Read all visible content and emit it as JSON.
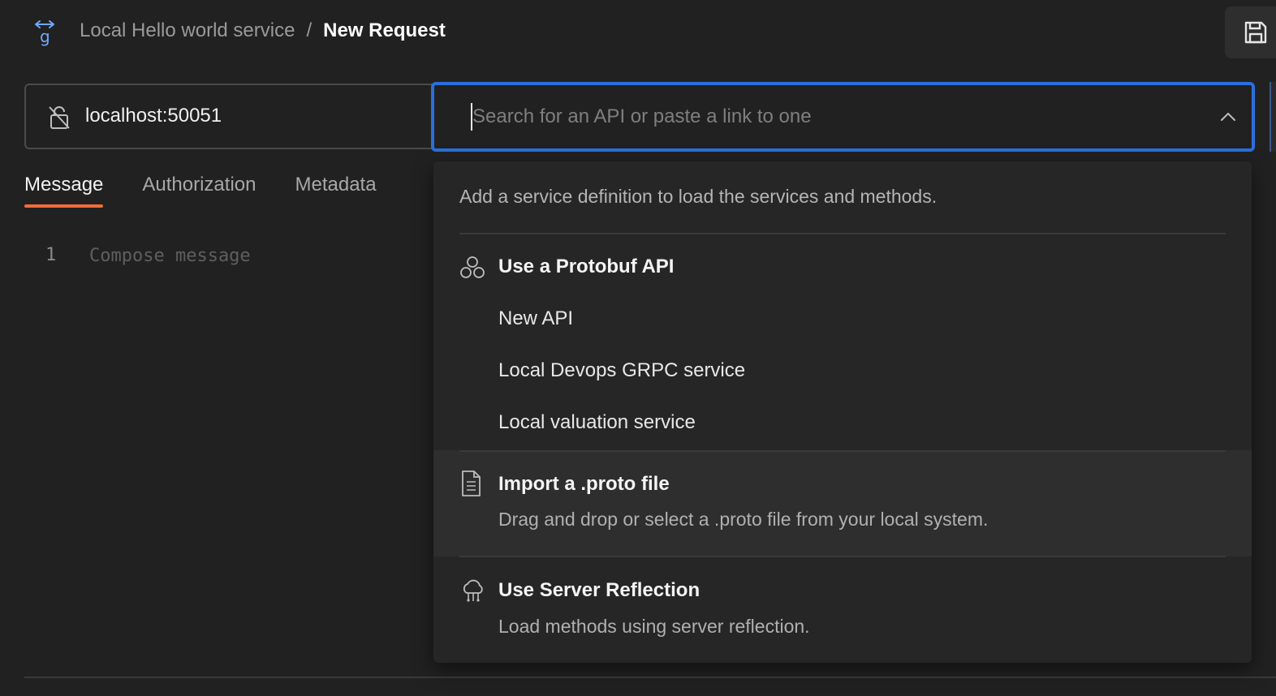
{
  "header": {
    "breadcrumb_parent": "Local Hello world service",
    "breadcrumb_separator": "/",
    "breadcrumb_current": "New Request",
    "logo_icon": "grpc-arrows-icon",
    "save_icon": "floppy-disk-icon"
  },
  "request": {
    "url": "localhost:50051",
    "tls_icon": "unlocked-slash-icon",
    "search_placeholder": "Search for an API or paste a link to one",
    "search_value": ""
  },
  "tabs": [
    {
      "label": "Message",
      "active": true
    },
    {
      "label": "Authorization",
      "active": false
    },
    {
      "label": "Metadata",
      "active": false
    }
  ],
  "editor": {
    "line_number": "1",
    "placeholder": "Compose message"
  },
  "dropdown": {
    "hint": "Add a service definition to load the services and methods.",
    "protobuf": {
      "title": "Use a Protobuf API",
      "icon": "hexagon-cluster-icon",
      "items": [
        "New API",
        "Local Devops GRPC service",
        "Local valuation service"
      ]
    },
    "import": {
      "title": "Import a .proto file",
      "description": "Drag and drop or select a .proto file from your local system.",
      "icon": "document-icon"
    },
    "reflection": {
      "title": "Use Server Reflection",
      "description": "Load methods using server reflection.",
      "icon": "cloud-network-icon"
    }
  },
  "colors": {
    "background": "#212121",
    "accent_tab": "#f26b3a",
    "focus_border": "#2a6fdb",
    "dropdown_bg": "#262626"
  }
}
